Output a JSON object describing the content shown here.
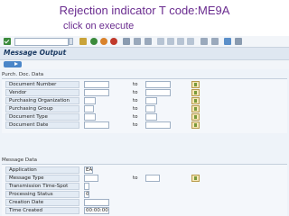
{
  "slide": {
    "title_line1": "Rejection indicator T code:ME9A",
    "title_line2": "click on execute"
  },
  "screen": {
    "title": "Message Output",
    "section_purch": "Purch. Doc. Data",
    "section_message": "Message Data",
    "to_label": "to",
    "purch_rows": [
      {
        "label": "Document Number",
        "value": "",
        "to_value": ""
      },
      {
        "label": "Vendor",
        "value": "",
        "to_value": ""
      },
      {
        "label": "Purchasing Organization",
        "value": "",
        "to_value": ""
      },
      {
        "label": "Purchasing Group",
        "value": "",
        "to_value": ""
      },
      {
        "label": "Document Type",
        "value": "",
        "to_value": ""
      },
      {
        "label": "Document Date",
        "value": "",
        "to_value": ""
      }
    ],
    "message_rows": [
      {
        "label": "Application",
        "value": "EA"
      },
      {
        "label": "Message Type",
        "value": "",
        "to_value": ""
      },
      {
        "label": "Transmission Time-Spot",
        "value": ""
      },
      {
        "label": "Processing Status",
        "value": "0"
      },
      {
        "label": "Creation Date",
        "value": ""
      },
      {
        "label": "Time Created",
        "value": "00:00:00"
      }
    ]
  },
  "colors": {
    "title_text": "#6a2c8f",
    "screen_bg": "#eef3f9",
    "execute_button": "#4b86c8",
    "label_bg": "#e3ebf4"
  },
  "icons": [
    "check-icon",
    "execute-icon",
    "multiple-selection-icon"
  ]
}
